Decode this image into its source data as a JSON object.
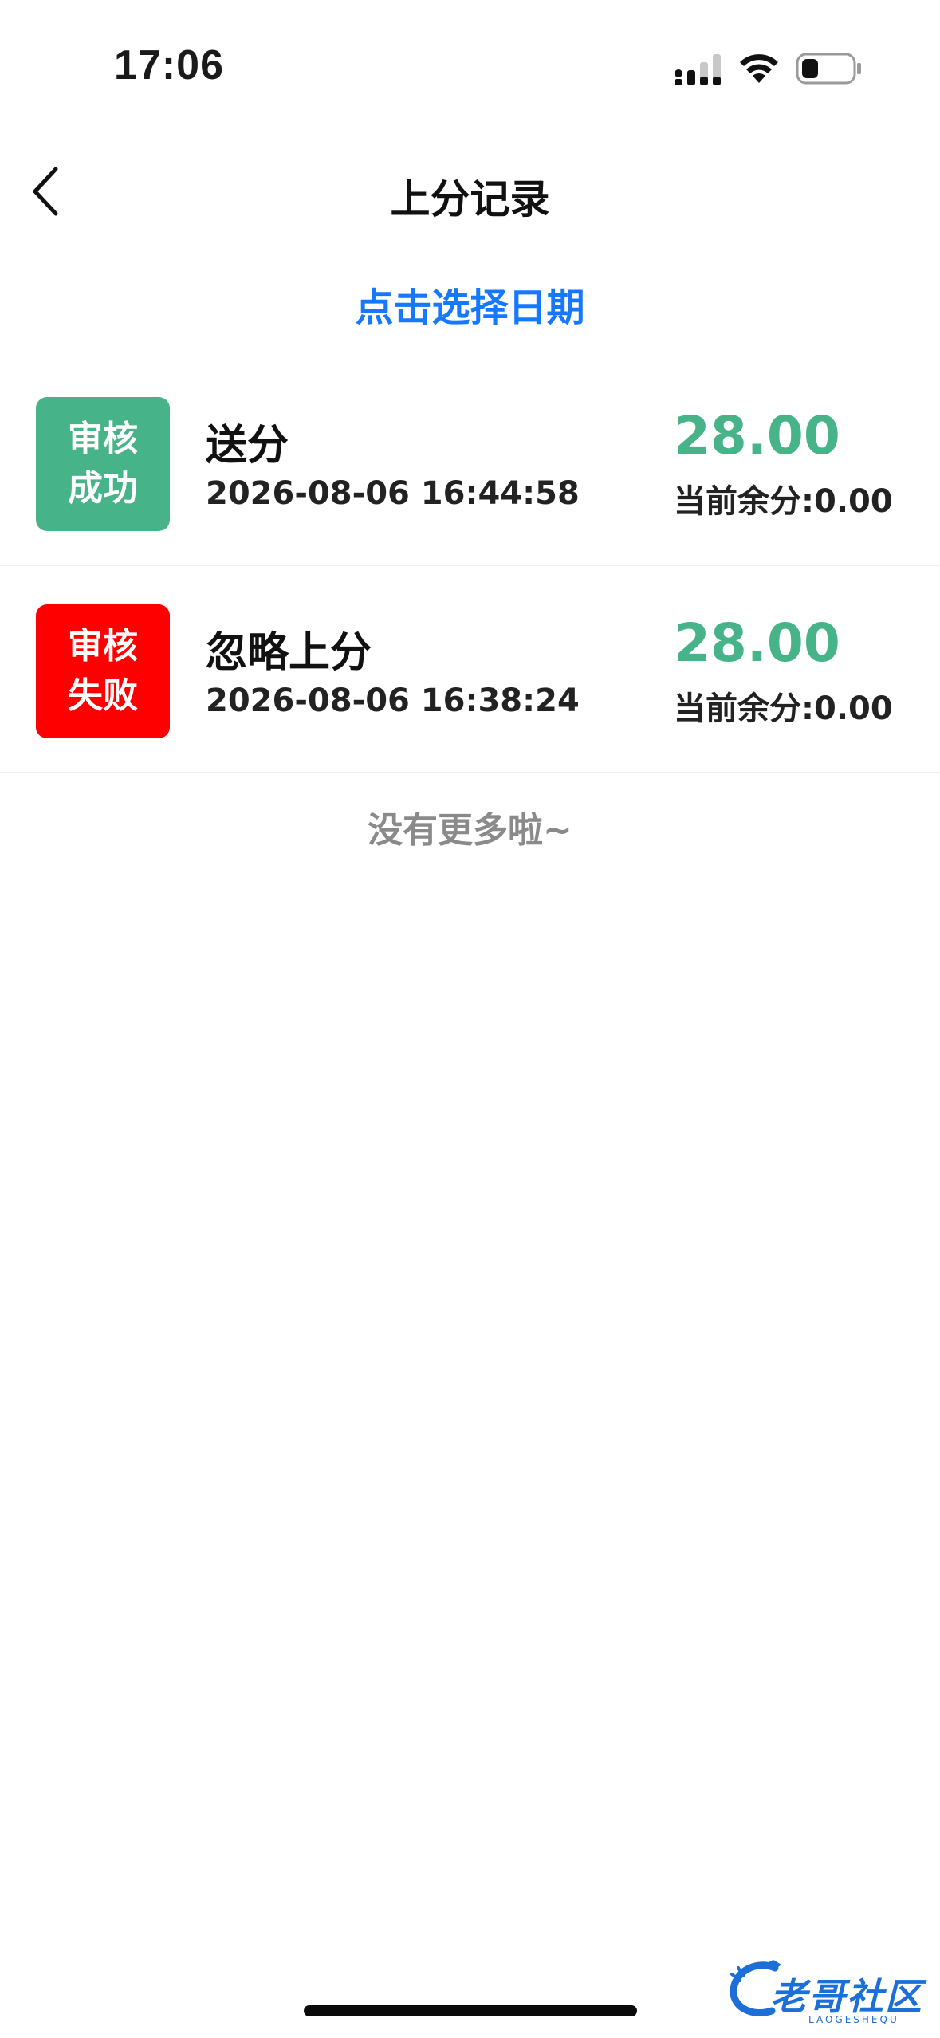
{
  "status_bar": {
    "time": "17:06"
  },
  "nav": {
    "title": "上分记录",
    "back_icon": "chevron-left-icon"
  },
  "date_picker": {
    "label": "点击选择日期"
  },
  "colors": {
    "accent_blue": "#1677ff",
    "success_green": "#46b488",
    "fail_red": "#ff0000",
    "muted_gray": "#8a8a8a"
  },
  "records": [
    {
      "status_line1": "审核",
      "status_line2": "成功",
      "status": "success",
      "title": "送分",
      "time": "2026-08-06 16:44:58",
      "amount": "28.00",
      "balance": "当前余分:0.00"
    },
    {
      "status_line1": "审核",
      "status_line2": "失败",
      "status": "fail",
      "title": "忽略上分",
      "time": "2026-08-06 16:38:24",
      "amount": "28.00",
      "balance": "当前余分:0.00"
    }
  ],
  "footer": {
    "no_more": "没有更多啦~"
  },
  "watermark": {
    "text": "老哥社区",
    "sub": "LAOGESHEQU"
  }
}
